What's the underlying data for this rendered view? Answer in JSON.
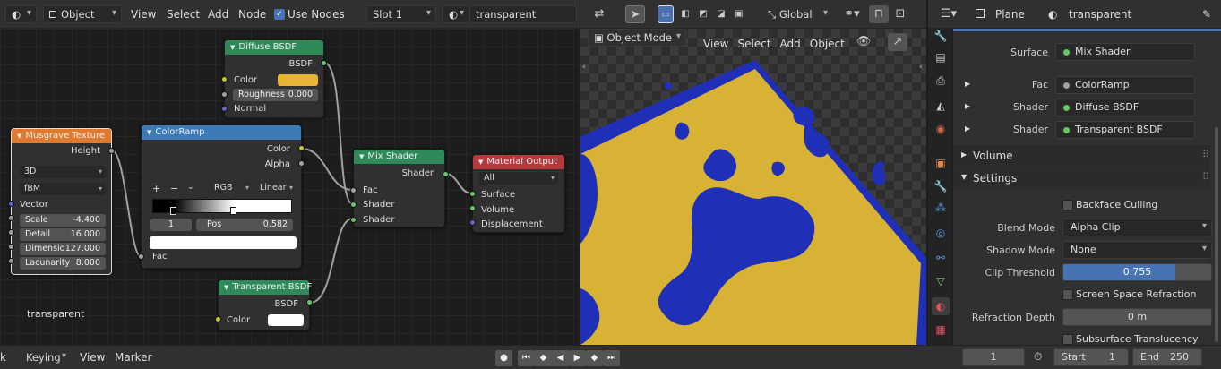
{
  "node_editor": {
    "header": {
      "object_label": "Object",
      "menus": [
        "View",
        "Select",
        "Add",
        "Node"
      ],
      "use_nodes_label": "Use Nodes",
      "slot": "Slot 1",
      "material": "transparent"
    },
    "material_label": "transparent",
    "musgrave": {
      "title": "Musgrave Texture",
      "out": "Height",
      "dim": "3D",
      "type": "fBM",
      "vector": "Vector",
      "fields": [
        {
          "label": "Scale",
          "value": "-4.400"
        },
        {
          "label": "Detail",
          "value": "16.000"
        },
        {
          "label": "Dimensio",
          "value": "127.000"
        },
        {
          "label": "Lacunarity",
          "value": "8.000"
        }
      ]
    },
    "colorramp": {
      "title": "ColorRamp",
      "out_color": "Color",
      "out_alpha": "Alpha",
      "mode": "RGB",
      "interp": "Linear",
      "index": "1",
      "pos_label": "Pos",
      "pos": "0.582",
      "fac": "Fac",
      "plus": "+",
      "minus": "−"
    },
    "diffuse": {
      "title": "Diffuse BSDF",
      "out": "BSDF",
      "color": "Color",
      "roughness_label": "Roughness",
      "roughness": "0.000",
      "normal": "Normal",
      "swatch": "#e8b434"
    },
    "mix": {
      "title": "Mix Shader",
      "out": "Shader",
      "fac": "Fac",
      "shader1": "Shader",
      "shader2": "Shader"
    },
    "transparent": {
      "title": "Transparent BSDF",
      "out": "BSDF",
      "color": "Color"
    },
    "output": {
      "title": "Material Output",
      "target": "All",
      "surface": "Surface",
      "volume": "Volume",
      "displacement": "Displacement"
    }
  },
  "viewport": {
    "header": {
      "mode": "Object Mode",
      "menus": [
        "View",
        "Select",
        "Add",
        "Object"
      ],
      "transform": "Global"
    },
    "colors": {
      "yellow": "#d8b235",
      "blue": "#1f2fb8"
    }
  },
  "properties": {
    "object": "Plane",
    "material": "transparent",
    "surface_label": "Surface",
    "surface": "Mix Shader",
    "fac_label": "Fac",
    "fac": "ColorRamp",
    "shader1_label": "Shader",
    "shader1": "Diffuse BSDF",
    "shader2_label": "Shader",
    "shader2": "Transparent BSDF",
    "volume": "Volume",
    "settings": "Settings",
    "backface": "Backface Culling",
    "blend_label": "Blend Mode",
    "blend": "Alpha Clip",
    "shadow_label": "Shadow Mode",
    "shadow": "None",
    "clip_label": "Clip Threshold",
    "clip": "0.755",
    "clip_fraction": 0.755,
    "ssr": "Screen Space Refraction",
    "refr_label": "Refraction Depth",
    "refr": "0 m",
    "sss": "Subsurface Translucency"
  },
  "timeline": {
    "keying": "Keying",
    "view": "View",
    "marker": "Marker",
    "frame": "1",
    "start_label": "Start",
    "start": "1",
    "end_label": "End",
    "end": "250"
  }
}
